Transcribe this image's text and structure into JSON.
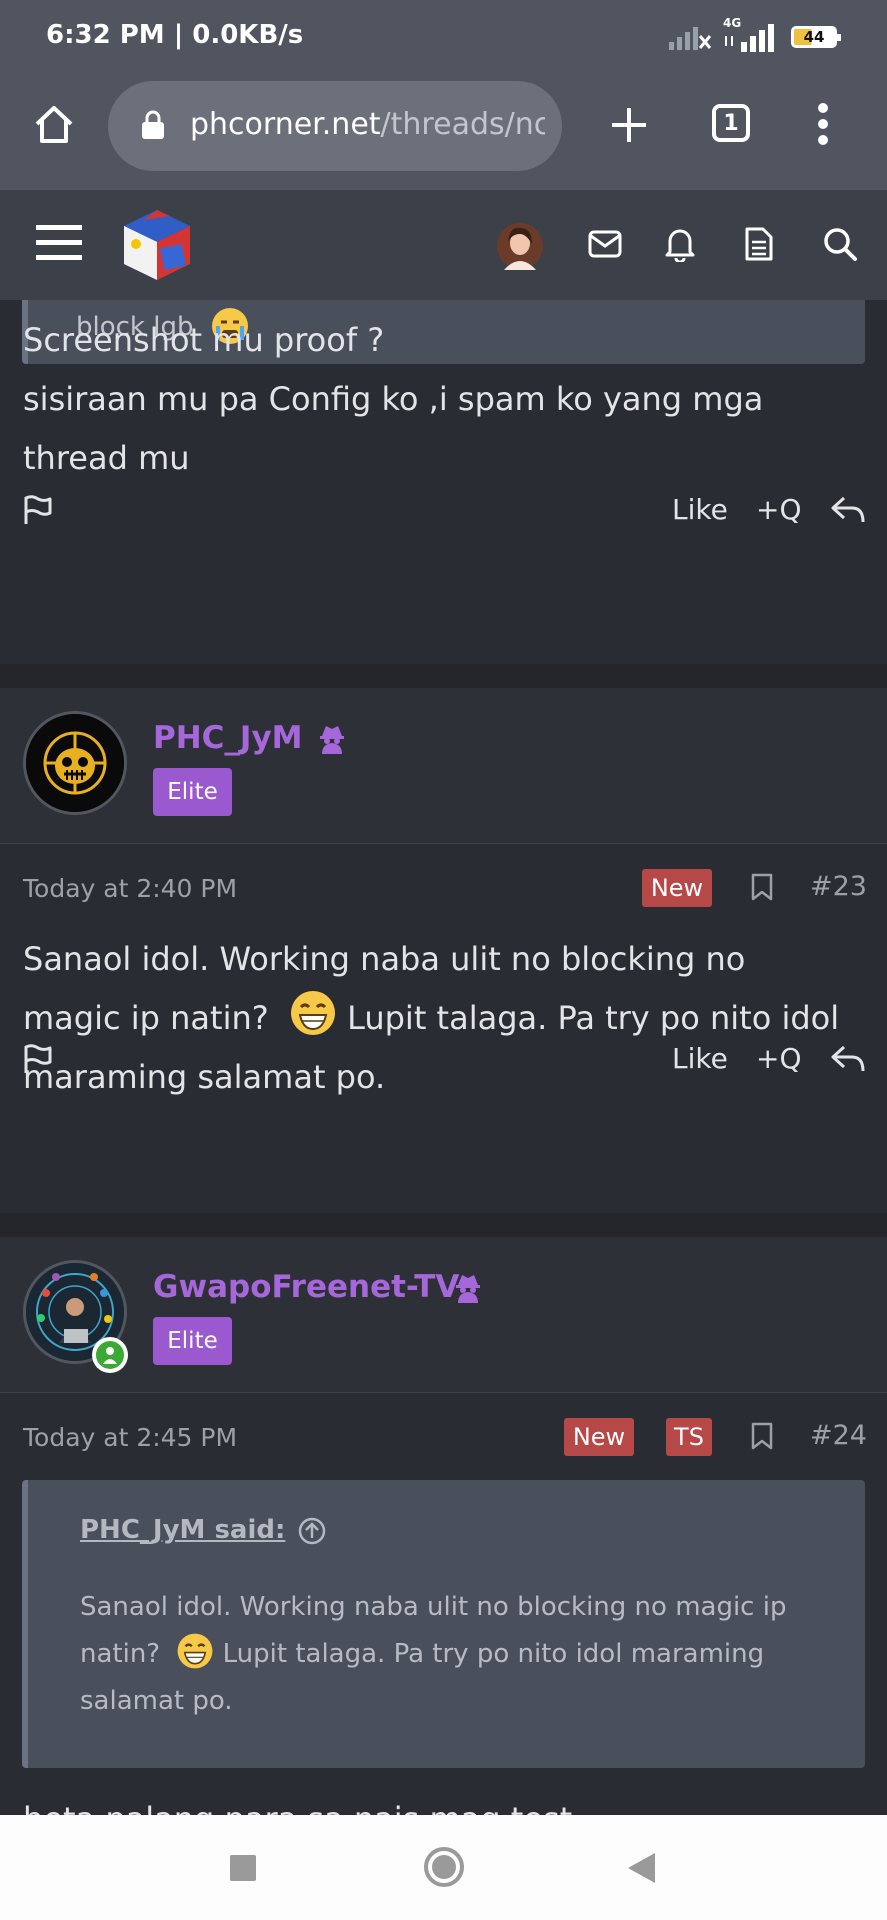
{
  "status_bar": {
    "time": "6:32 PM | 0.0KB/s",
    "network": "4G",
    "battery": "44"
  },
  "browser": {
    "url_host": "phcorner.net",
    "url_path": "/threads/nc",
    "tab_count": "1"
  },
  "posts": [
    {
      "quote_tail": "block lgb",
      "text_lines": [
        "Screenshot mu proof ?",
        "sisiraan mu pa Config ko ,i spam ko yang mga",
        "thread mu"
      ],
      "actions": {
        "like": "Like",
        "quote": "+Q"
      }
    },
    {
      "username": "PHC_JyM",
      "badge": "Elite",
      "date": "Today at 2:40 PM",
      "new_tag": "New",
      "number": "#23",
      "text_parts": [
        "Sanaol idol. Working naba ulit no blocking no",
        "magic ip natin?",
        " Lupit talaga. Pa try po nito idol",
        "maraming salamat po."
      ],
      "actions": {
        "like": "Like",
        "quote": "+Q"
      }
    },
    {
      "username": "GwapoFreenet-TV",
      "badge": "Elite",
      "date": "Today at 2:45 PM",
      "new_tag": "New",
      "ts_tag": "TS",
      "number": "#24",
      "quote": {
        "author": "PHC_JyM said:",
        "lines": [
          "Sanaol idol. Working naba ulit no blocking no magic ip",
          "natin?",
          " Lupit talaga. Pa try po nito idol maraming",
          "salamat po."
        ]
      },
      "partial_text": "beta palang para sa nais mag test"
    }
  ],
  "colors": {
    "accent": "#a567d9",
    "badge": "#9b59d0",
    "new_tag": "#b74848"
  }
}
